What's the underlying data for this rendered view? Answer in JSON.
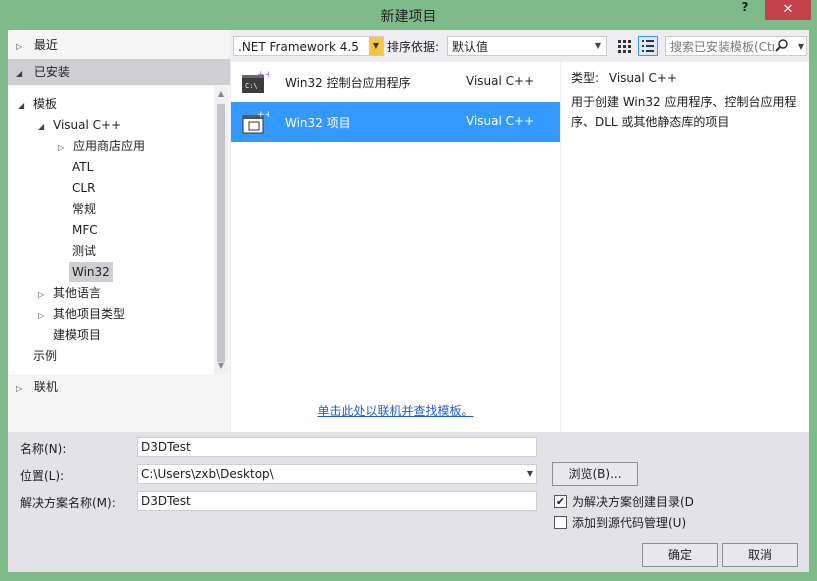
{
  "window": {
    "title": "新建项目",
    "help": "?",
    "close": "✕"
  },
  "sidebar": {
    "recent": "最近",
    "installed": "已安装",
    "templates": "模板",
    "visual_cpp": "Visual C++",
    "store_apps": "应用商店应用",
    "atl": "ATL",
    "clr": "CLR",
    "general": "常规",
    "mfc": "MFC",
    "test": "测试",
    "win32": "Win32",
    "other_languages": "其他语言",
    "other_project_types": "其他项目类型",
    "modeling_projects": "建模项目",
    "samples": "示例",
    "online": "联机"
  },
  "toolbar": {
    "framework": ".NET Framework 4.5",
    "sort_label": "排序依据:",
    "sort_value": "默认值",
    "search_placeholder": "搜索已安装模板(Ctr"
  },
  "templates": [
    {
      "name": "Win32 控制台应用程序",
      "language": "Visual C++"
    },
    {
      "name": "Win32 项目",
      "language": "Visual C++"
    }
  ],
  "online_link": "单击此处以联机并查找模板。",
  "description": {
    "type_label": "类型:",
    "type_value": "Visual C++",
    "text": "用于创建 Win32 应用程序、控制台应用程序、DLL 或其他静态库的项目"
  },
  "form": {
    "name_label": "名称(N):",
    "name_value": "D3DTest",
    "location_label": "位置(L):",
    "location_value": "C:\\Users\\zxb\\Desktop\\",
    "solution_label": "解决方案名称(M):",
    "solution_value": "D3DTest",
    "browse_label": "浏览(B)...",
    "create_dir_label": "为解决方案创建目录(D",
    "add_source_control_label": "添加到源代码管理(U)",
    "ok_label": "确定",
    "cancel_label": "取消"
  }
}
